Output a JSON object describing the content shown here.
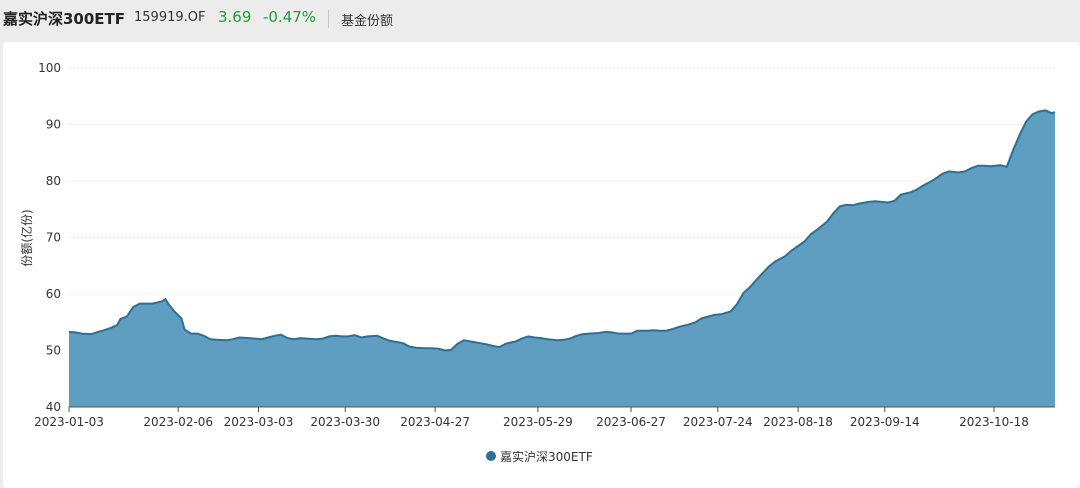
{
  "header": {
    "title": "嘉实沪深300ETF",
    "code": "159919.OF",
    "price": "3.69",
    "change": "-0.47%",
    "metric": "基金份额"
  },
  "colors": {
    "fill": "#5f9ec0",
    "line": "#2e6f94",
    "up_down": "#1e9e3a"
  },
  "chart_data": {
    "type": "area",
    "ylabel": "份额(亿份)",
    "xlabel": "",
    "ylim": [
      40,
      100
    ],
    "yticks": [
      40,
      50,
      60,
      70,
      80,
      90,
      100
    ],
    "xticks": [
      "2023-01-03",
      "2023-02-06",
      "2023-03-03",
      "2023-03-30",
      "2023-04-27",
      "2023-05-29",
      "2023-06-27",
      "2023-07-24",
      "2023-08-18",
      "2023-09-14",
      "2023-10-18"
    ],
    "grid": true,
    "legend_position": "bottom",
    "series": [
      {
        "name": "嘉实沪深300ETF",
        "points": [
          [
            "2023-01-03",
            53.3
          ],
          [
            "2023-01-05",
            53.2
          ],
          [
            "2023-01-07",
            53.0
          ],
          [
            "2023-01-10",
            52.9
          ],
          [
            "2023-01-12",
            53.3
          ],
          [
            "2023-01-14",
            53.6
          ],
          [
            "2023-01-16",
            54.0
          ],
          [
            "2023-01-18",
            54.5
          ],
          [
            "2023-01-19",
            55.6
          ],
          [
            "2023-01-21",
            56.0
          ],
          [
            "2023-01-23",
            57.7
          ],
          [
            "2023-01-25",
            58.3
          ],
          [
            "2023-01-27",
            58.3
          ],
          [
            "2023-01-29",
            58.3
          ],
          [
            "2023-02-01",
            58.7
          ],
          [
            "2023-02-02",
            59.1
          ],
          [
            "2023-02-03",
            58.2
          ],
          [
            "2023-02-05",
            56.8
          ],
          [
            "2023-02-07",
            55.7
          ],
          [
            "2023-02-08",
            53.7
          ],
          [
            "2023-02-10",
            53.0
          ],
          [
            "2023-02-12",
            53.0
          ],
          [
            "2023-02-14",
            52.6
          ],
          [
            "2023-02-16",
            52.0
          ],
          [
            "2023-02-18",
            51.9
          ],
          [
            "2023-02-21",
            51.8
          ],
          [
            "2023-02-23",
            52.0
          ],
          [
            "2023-02-25",
            52.3
          ],
          [
            "2023-02-28",
            52.2
          ],
          [
            "2023-03-02",
            52.1
          ],
          [
            "2023-03-04",
            52.0
          ],
          [
            "2023-03-06",
            52.3
          ],
          [
            "2023-03-08",
            52.6
          ],
          [
            "2023-03-10",
            52.8
          ],
          [
            "2023-03-12",
            52.2
          ],
          [
            "2023-03-14",
            52.0
          ],
          [
            "2023-03-16",
            52.2
          ],
          [
            "2023-03-18",
            52.1
          ],
          [
            "2023-03-21",
            52.0
          ],
          [
            "2023-03-23",
            52.1
          ],
          [
            "2023-03-25",
            52.5
          ],
          [
            "2023-03-27",
            52.6
          ],
          [
            "2023-03-29",
            52.5
          ],
          [
            "2023-03-31",
            52.5
          ],
          [
            "2023-04-02",
            52.7
          ],
          [
            "2023-04-04",
            52.3
          ],
          [
            "2023-04-06",
            52.5
          ],
          [
            "2023-04-09",
            52.6
          ],
          [
            "2023-04-11",
            52.1
          ],
          [
            "2023-04-13",
            51.7
          ],
          [
            "2023-04-15",
            51.5
          ],
          [
            "2023-04-17",
            51.3
          ],
          [
            "2023-04-19",
            50.7
          ],
          [
            "2023-04-21",
            50.5
          ],
          [
            "2023-04-24",
            50.4
          ],
          [
            "2023-04-26",
            50.4
          ],
          [
            "2023-04-28",
            50.3
          ],
          [
            "2023-04-30",
            50.0
          ],
          [
            "2023-05-02",
            50.1
          ],
          [
            "2023-05-04",
            51.2
          ],
          [
            "2023-05-06",
            51.8
          ],
          [
            "2023-05-09",
            51.5
          ],
          [
            "2023-05-11",
            51.3
          ],
          [
            "2023-05-13",
            51.1
          ],
          [
            "2023-05-15",
            50.8
          ],
          [
            "2023-05-17",
            50.6
          ],
          [
            "2023-05-19",
            51.2
          ],
          [
            "2023-05-22",
            51.6
          ],
          [
            "2023-05-24",
            52.1
          ],
          [
            "2023-05-26",
            52.5
          ],
          [
            "2023-05-28",
            52.3
          ],
          [
            "2023-05-30",
            52.2
          ],
          [
            "2023-06-01",
            52.0
          ],
          [
            "2023-06-04",
            51.8
          ],
          [
            "2023-06-06",
            51.9
          ],
          [
            "2023-06-08",
            52.1
          ],
          [
            "2023-06-10",
            52.6
          ],
          [
            "2023-06-12",
            52.9
          ],
          [
            "2023-06-14",
            53.0
          ],
          [
            "2023-06-17",
            53.1
          ],
          [
            "2023-06-19",
            53.3
          ],
          [
            "2023-06-21",
            53.2
          ],
          [
            "2023-06-23",
            53.0
          ],
          [
            "2023-06-25",
            53.0
          ],
          [
            "2023-06-27",
            53.0
          ],
          [
            "2023-06-29",
            53.5
          ],
          [
            "2023-07-02",
            53.5
          ],
          [
            "2023-07-04",
            53.6
          ],
          [
            "2023-07-06",
            53.5
          ],
          [
            "2023-07-08",
            53.5
          ],
          [
            "2023-07-10",
            53.8
          ],
          [
            "2023-07-12",
            54.2
          ],
          [
            "2023-07-15",
            54.6
          ],
          [
            "2023-07-17",
            55.0
          ],
          [
            "2023-07-19",
            55.7
          ],
          [
            "2023-07-21",
            56.0
          ],
          [
            "2023-07-23",
            56.3
          ],
          [
            "2023-07-25",
            56.4
          ],
          [
            "2023-07-28",
            56.9
          ],
          [
            "2023-07-30",
            58.2
          ],
          [
            "2023-08-01",
            60.2
          ],
          [
            "2023-08-03",
            61.2
          ],
          [
            "2023-08-05",
            62.5
          ],
          [
            "2023-08-07",
            63.7
          ],
          [
            "2023-08-09",
            64.9
          ],
          [
            "2023-08-11",
            65.8
          ],
          [
            "2023-08-14",
            66.7
          ],
          [
            "2023-08-16",
            67.7
          ],
          [
            "2023-08-18",
            68.5
          ],
          [
            "2023-08-20",
            69.3
          ],
          [
            "2023-08-22",
            70.6
          ],
          [
            "2023-08-24",
            71.4
          ],
          [
            "2023-08-27",
            72.8
          ],
          [
            "2023-08-29",
            74.3
          ],
          [
            "2023-08-31",
            75.5
          ],
          [
            "2023-09-02",
            75.8
          ],
          [
            "2023-09-04",
            75.7
          ],
          [
            "2023-09-06",
            76.0
          ],
          [
            "2023-09-09",
            76.3
          ],
          [
            "2023-09-11",
            76.4
          ],
          [
            "2023-09-13",
            76.3
          ],
          [
            "2023-09-15",
            76.2
          ],
          [
            "2023-09-17",
            76.5
          ],
          [
            "2023-09-19",
            77.6
          ],
          [
            "2023-09-22",
            78.0
          ],
          [
            "2023-09-24",
            78.5
          ],
          [
            "2023-09-26",
            79.2
          ],
          [
            "2023-09-28",
            79.8
          ],
          [
            "2023-09-30",
            80.5
          ],
          [
            "2023-10-02",
            81.3
          ],
          [
            "2023-10-04",
            81.7
          ],
          [
            "2023-10-07",
            81.5
          ],
          [
            "2023-10-09",
            81.7
          ],
          [
            "2023-10-11",
            82.3
          ],
          [
            "2023-10-13",
            82.7
          ],
          [
            "2023-10-15",
            82.7
          ],
          [
            "2023-10-17",
            82.6
          ],
          [
            "2023-10-20",
            82.8
          ],
          [
            "2023-10-22",
            82.5
          ],
          [
            "2023-10-24",
            85.5
          ],
          [
            "2023-10-26",
            88.2
          ],
          [
            "2023-10-28",
            90.5
          ],
          [
            "2023-10-30",
            91.8
          ],
          [
            "2023-11-01",
            92.3
          ],
          [
            "2023-11-03",
            92.5
          ],
          [
            "2023-11-05",
            92.0
          ],
          [
            "2023-11-06",
            92.2
          ]
        ]
      }
    ]
  }
}
